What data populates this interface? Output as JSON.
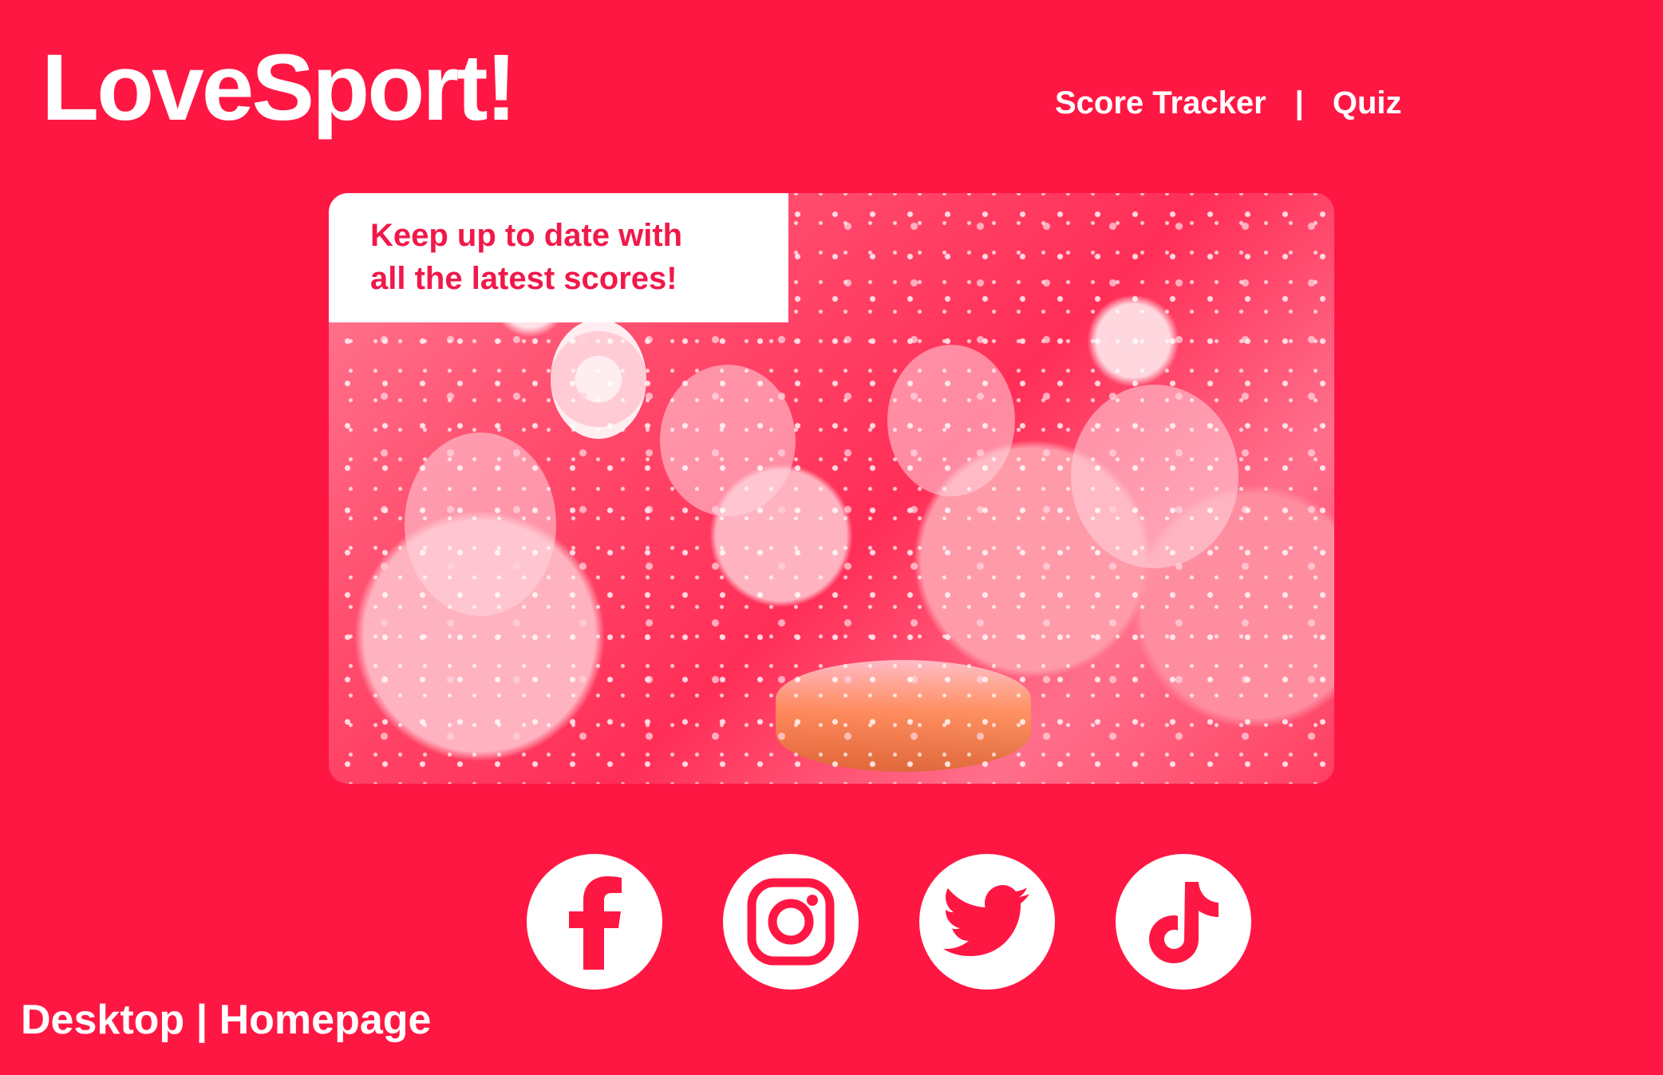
{
  "brand": {
    "logo_text": "LoveSport!"
  },
  "nav": {
    "items": [
      {
        "label": "Score Tracker"
      },
      {
        "label": "Quiz"
      }
    ],
    "separator": "|"
  },
  "hero": {
    "callout_line_1": "Keep up to date with",
    "callout_line_2": "all the latest scores!"
  },
  "social": {
    "icons": [
      "facebook-icon",
      "instagram-icon",
      "twitter-icon",
      "tiktok-icon"
    ]
  },
  "footer": {
    "label": "Desktop | Homepage"
  },
  "colors": {
    "background": "#ff1744",
    "callout_text": "#f0194a",
    "foreground": "#ffffff"
  }
}
